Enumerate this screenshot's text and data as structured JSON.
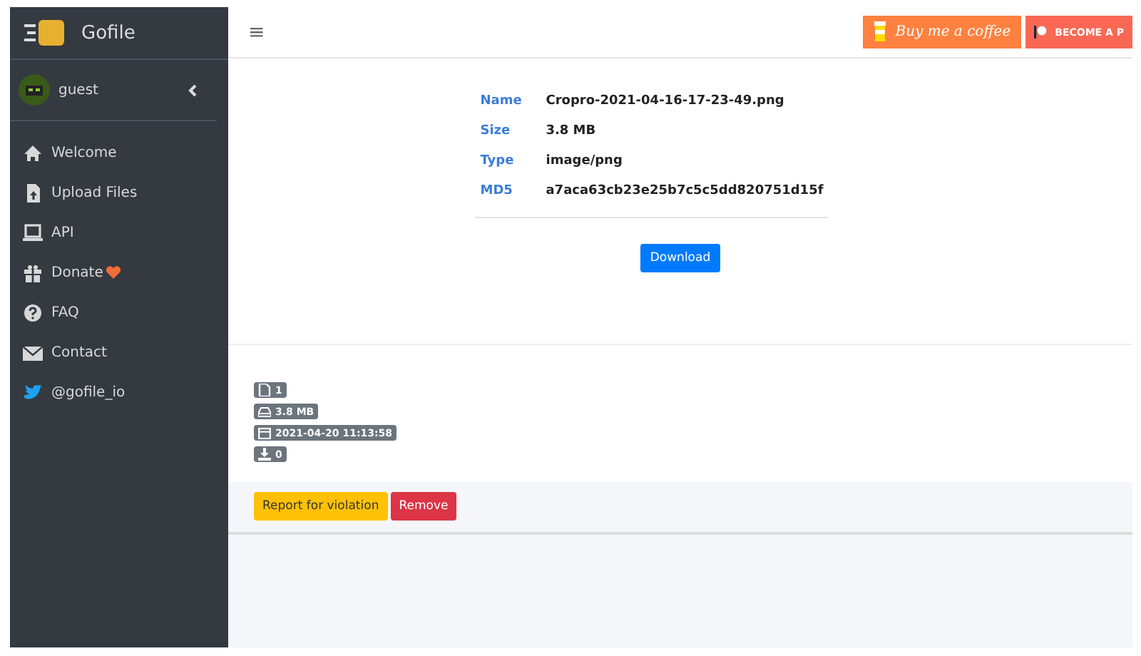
{
  "brand": {
    "name": "Gofile"
  },
  "user": {
    "name": "guest"
  },
  "sidebar": {
    "items": [
      {
        "kind": "home",
        "label": "Welcome"
      },
      {
        "kind": "upload",
        "label": "Upload Files"
      },
      {
        "kind": "laptop",
        "label": "API"
      },
      {
        "kind": "gift",
        "label": "Donate",
        "heart": true
      },
      {
        "kind": "question",
        "label": "FAQ"
      },
      {
        "kind": "mail",
        "label": "Contact"
      },
      {
        "kind": "bird",
        "label": "@gofile_io"
      }
    ]
  },
  "topbar": {
    "menu_icon": "≡",
    "coffee_label": "Buy me a coffee",
    "patreon_label": "BECOME A P"
  },
  "file_info": [
    {
      "label": "Name",
      "value": "Cropro-2021-04-16-17-23-49.png"
    },
    {
      "label": "Size",
      "value": "3.8 MB"
    },
    {
      "label": "Type",
      "value": "image/png"
    },
    {
      "label": "MD5",
      "value": "a7aca63cb23e25b7c5c5dd820751d15f"
    }
  ],
  "download_button": "Download",
  "stats": [
    {
      "kind": "file",
      "text": "1"
    },
    {
      "kind": "drive",
      "text": "3.8 MB"
    },
    {
      "kind": "calendar",
      "text": "2021-04-20 11:13:58"
    },
    {
      "kind": "download",
      "text": "0"
    }
  ],
  "actions": {
    "report": "Report for violation",
    "remove": "Remove"
  }
}
